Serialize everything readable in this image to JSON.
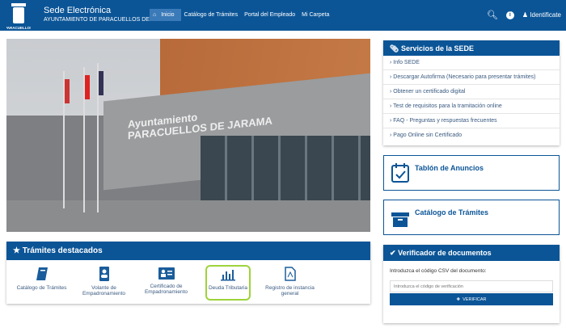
{
  "header": {
    "logo_text": "PARACUELLOS DE JARAMA",
    "title": "Sede Electrónica",
    "subtitle": "AYUNTAMIENTO DE PARACUELLOS DE JARAMA",
    "nav": [
      "Inicio",
      "Catálogo de Trámites",
      "Portal del Empleado",
      "Mi Carpeta"
    ],
    "login": "Identificate"
  },
  "photo": {
    "sign_line1": "Ayuntamiento",
    "sign_line2": "PARACUELLOS DE JARAMA"
  },
  "servicios": {
    "title": "Servicios de la SEDE",
    "items": [
      "Info SEDE",
      "Descargar Autofirma (Necesario para presentar trámites)",
      "Obtener un certificado digital",
      "Test de requisitos para la tramitación online",
      "FAQ - Preguntas y respuestas frecuentes",
      "Pago Online sin Certificado"
    ]
  },
  "tablon": "Tablón de Anuncios",
  "catalogo": "Catálogo de Trámites",
  "tramites": {
    "title": "Trámites destacados",
    "items": [
      "Catálogo de Trámites",
      "Volante de Empadronamiento",
      "Certificado de Empadronamiento",
      "Deuda Tributaria",
      "Registro de instancia general"
    ]
  },
  "verificador": {
    "title": "Verificador de documentos",
    "prompt": "Introduzca el código CSV del documento:",
    "placeholder": "Introduzca el código de verificación",
    "button": "VERIFICAR"
  },
  "colors": {
    "primary": "#0b5597",
    "highlight": "#9ed33a"
  }
}
